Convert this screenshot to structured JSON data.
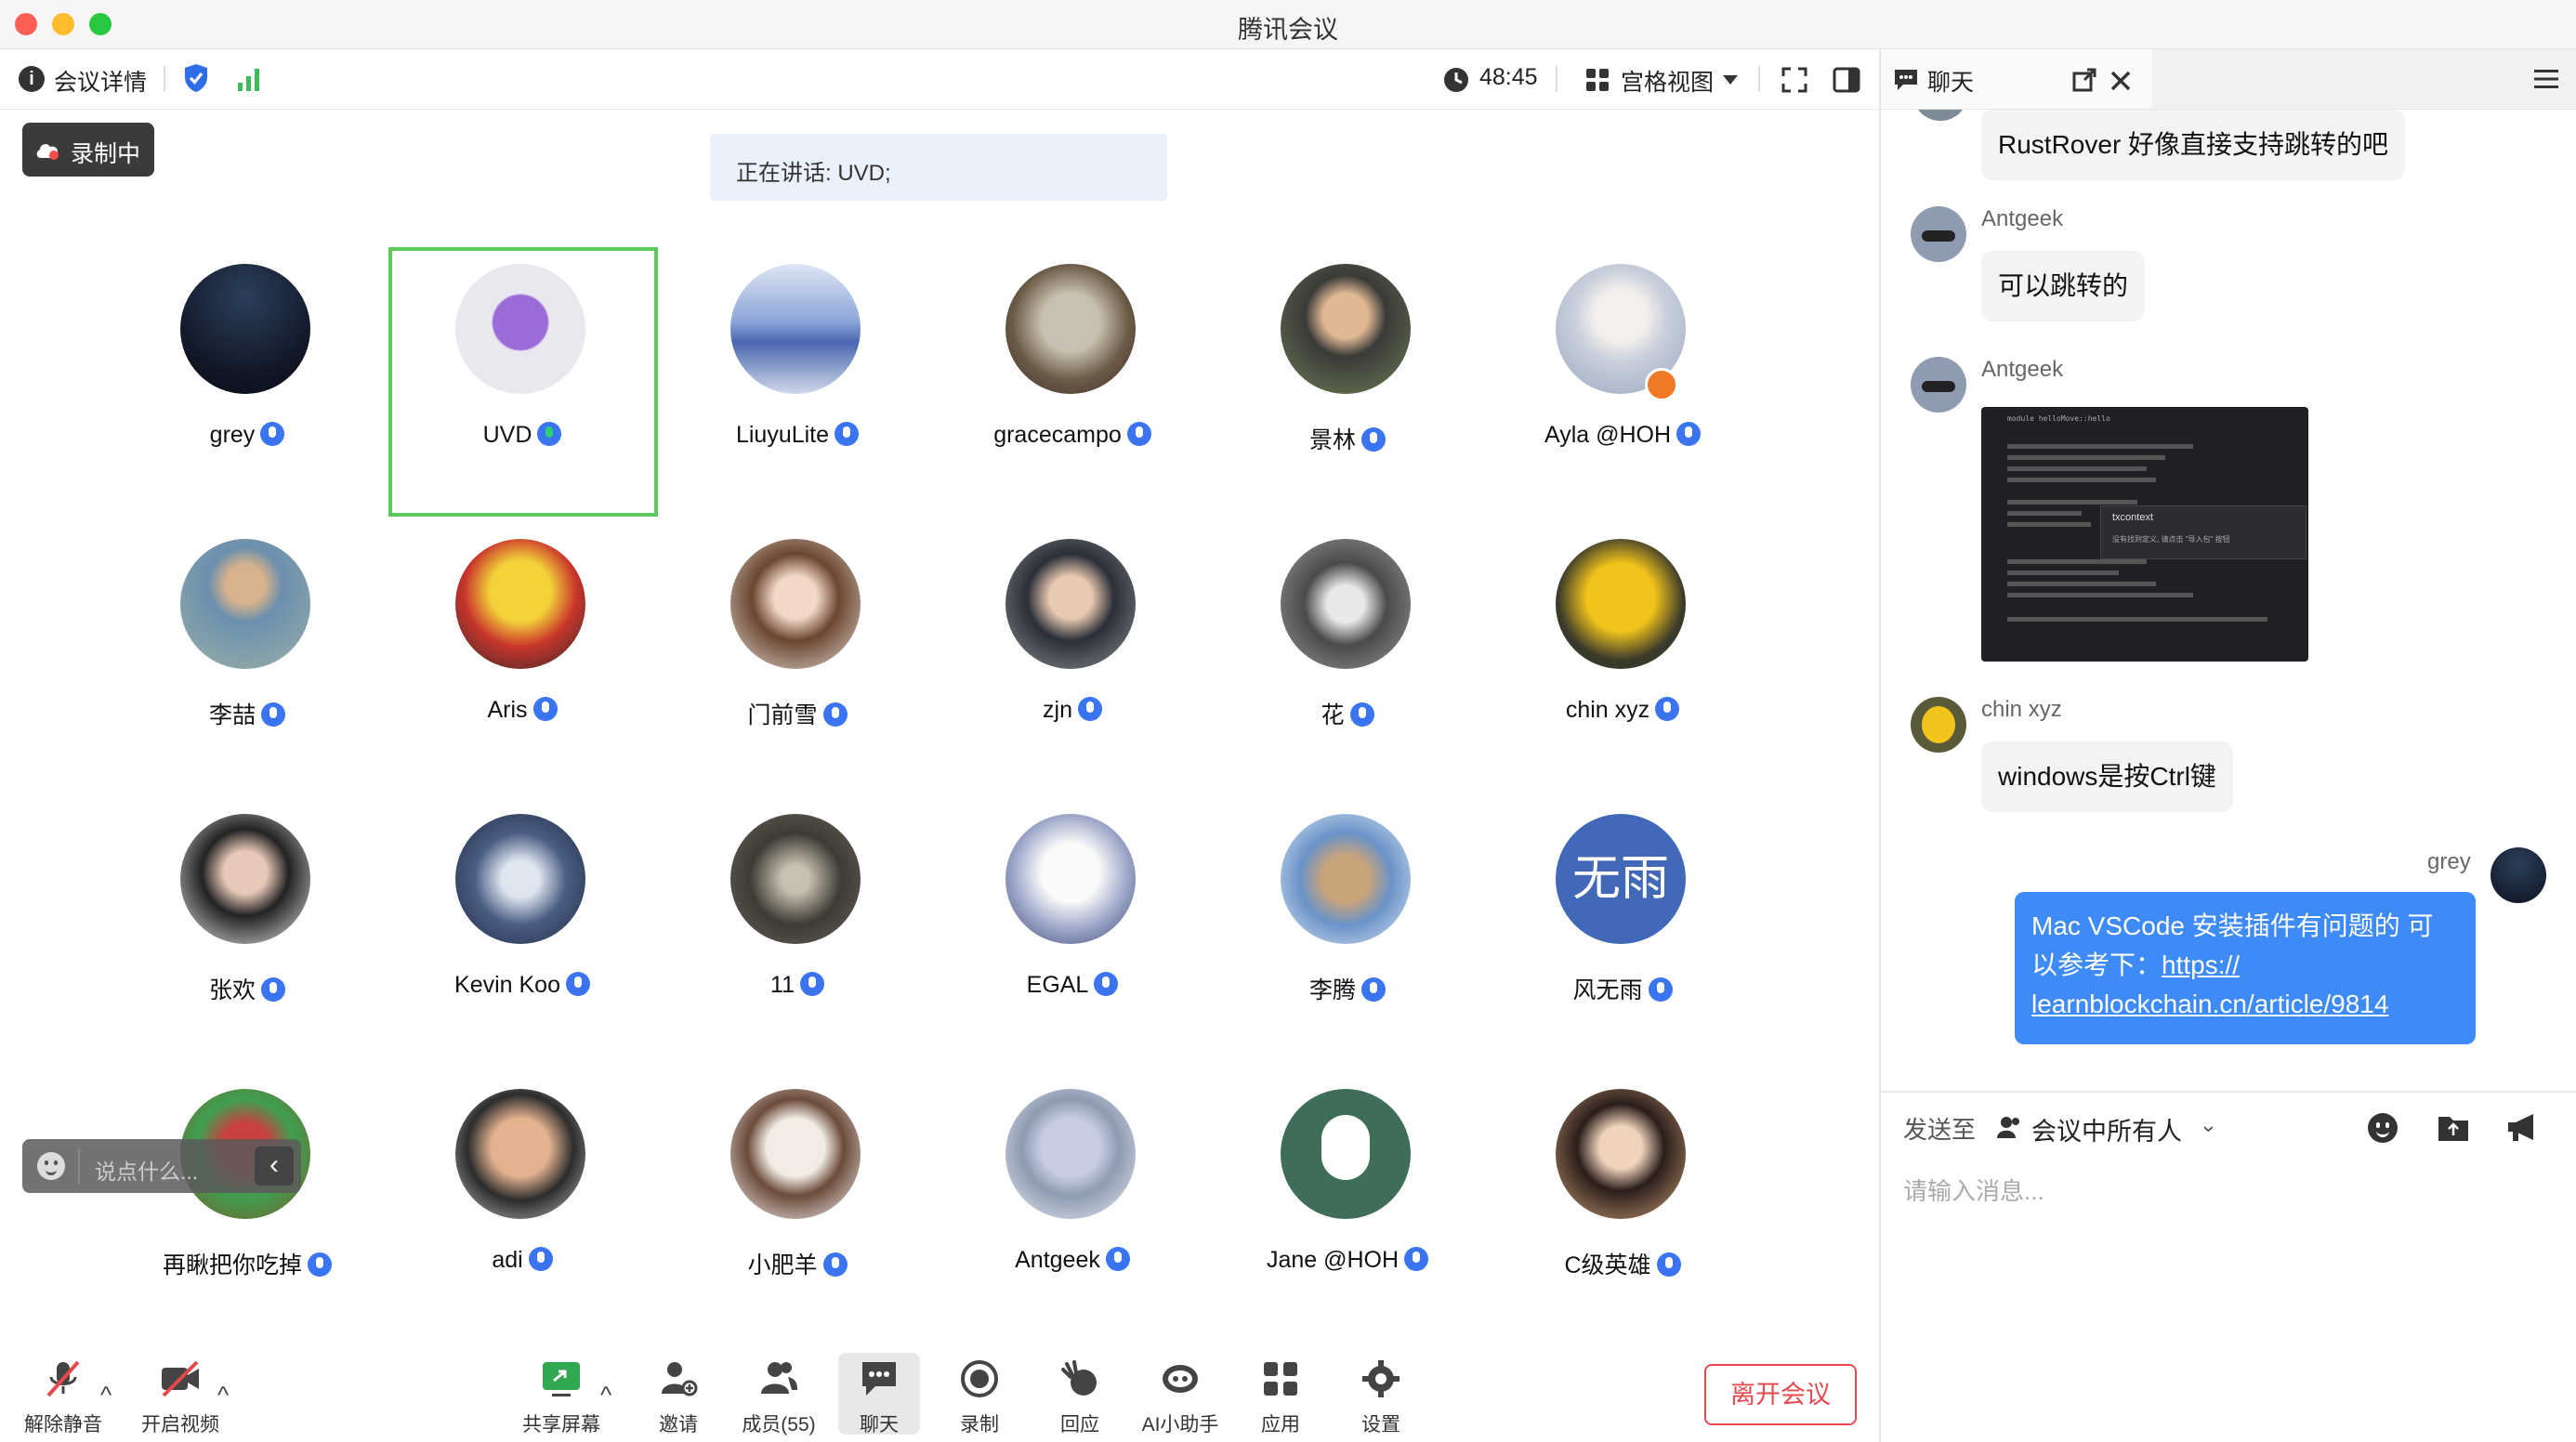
{
  "window": {
    "title": "腾讯会议"
  },
  "toolbar": {
    "meeting_info_label": "会议详情",
    "timer": "48:45",
    "view_label": "宫格视图"
  },
  "recording_badge": "录制中",
  "speaking_banner": "正在讲话: UVD;",
  "participants": [
    {
      "name": "grey"
    },
    {
      "name": "UVD"
    },
    {
      "name": "LiuyuLite"
    },
    {
      "name": "gracecampo"
    },
    {
      "name": "景林"
    },
    {
      "name": "Ayla @HOH"
    },
    {
      "name": "李喆"
    },
    {
      "name": "Aris"
    },
    {
      "name": "门前雪"
    },
    {
      "name": "zjn"
    },
    {
      "name": "花"
    },
    {
      "name": "chin xyz"
    },
    {
      "name": "张欢"
    },
    {
      "name": "Kevin Koo"
    },
    {
      "name": "11"
    },
    {
      "name": "EGAL"
    },
    {
      "name": "李腾"
    },
    {
      "name": "风无雨"
    },
    {
      "name": "再瞅把你吃掉"
    },
    {
      "name": "adi"
    },
    {
      "name": "小肥羊"
    },
    {
      "name": "Antgeek"
    },
    {
      "name": "Jane @HOH"
    },
    {
      "name": "C级英雄"
    }
  ],
  "avatar_text": {
    "fengwuyu": "无雨"
  },
  "quick_reply": {
    "placeholder": "说点什么..."
  },
  "bottom_bar": {
    "unmute": "解除静音",
    "start_video": "开启视频",
    "share_screen": "共享屏幕",
    "invite": "邀请",
    "members": "成员(55)",
    "chat": "聊天",
    "record": "录制",
    "react": "回应",
    "ai_assistant": "AI小助手",
    "apps": "应用",
    "settings": "设置",
    "leave": "离开会议"
  },
  "chat": {
    "title": "聊天",
    "messages": [
      {
        "sender": "",
        "text": "RustRover 好像直接支持跳转的吧"
      },
      {
        "sender": "Antgeek",
        "text": "可以跳转的"
      },
      {
        "sender": "Antgeek",
        "image_code": {
          "line1": "module helloMove::hello",
          "tooltip_title": "txcontext",
          "tooltip_text": "没有找到定义, 请点击 \"导入包\" 按钮"
        }
      },
      {
        "sender": "chin xyz",
        "text": "windows是按Ctrl键"
      },
      {
        "sender": "grey",
        "text_line1": "Mac VSCode 安装插件有问题的 可",
        "text_line2": "以参考下：",
        "link_part1": "https://",
        "link_part2": "learnblockchain.cn/article/9814"
      }
    ],
    "send_to_label": "发送至",
    "recipient": "会议中所有人",
    "input_placeholder": "请输入消息..."
  },
  "colors": {
    "accent": "#3a74f0",
    "leave": "#e5484d",
    "speaker_border": "#5cc85c",
    "own_bubble": "#3e8af7"
  }
}
